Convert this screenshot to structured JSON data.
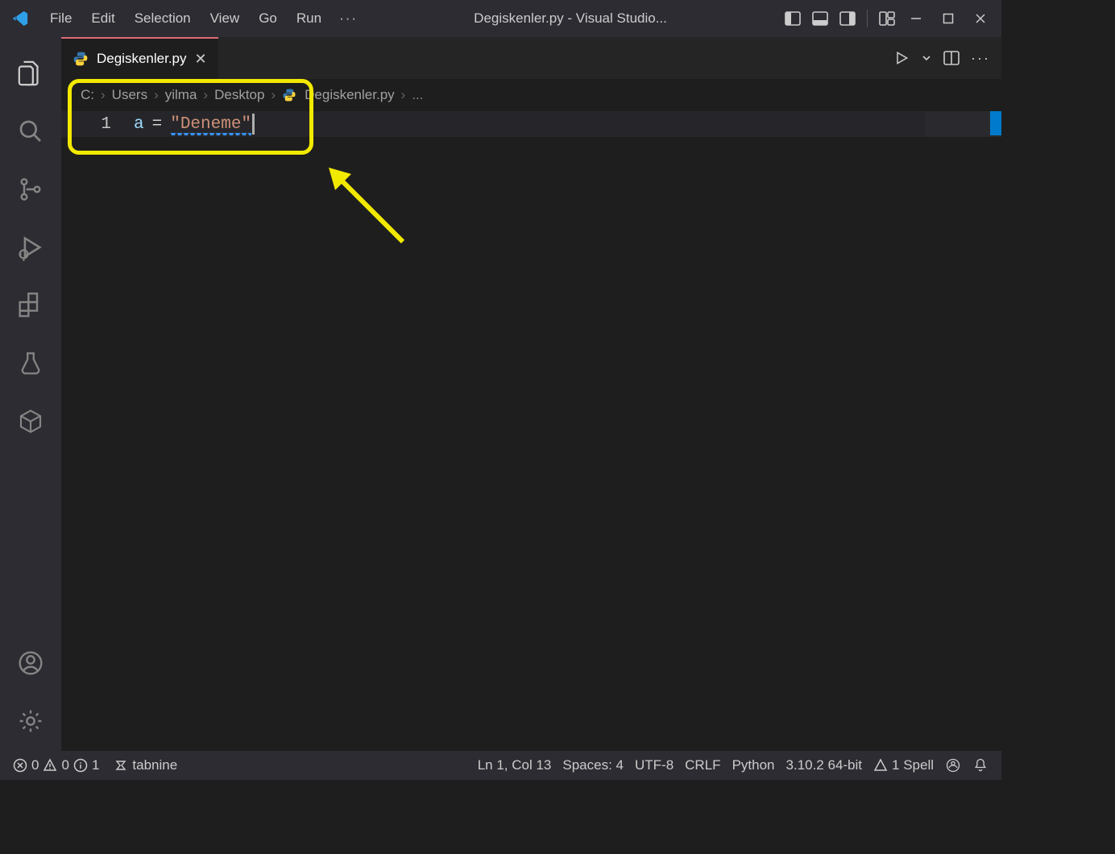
{
  "titlebar": {
    "menus": [
      "File",
      "Edit",
      "Selection",
      "View",
      "Go",
      "Run"
    ],
    "more": "···",
    "title": "Degiskenler.py - Visual Studio..."
  },
  "tab": {
    "label": "Degiskenler.py"
  },
  "breadcrumb": {
    "parts": [
      "C:",
      "Users",
      "yilma",
      "Desktop"
    ],
    "file": "Degiskenler.py",
    "more": "..."
  },
  "code": {
    "line_number": "1",
    "variable": "a",
    "operator": "=",
    "string": "\"Deneme\""
  },
  "status": {
    "errors": "0",
    "warnings": "0",
    "info": "1",
    "ext": "tabnine",
    "cursor": "Ln 1, Col 13",
    "spaces": "Spaces: 4",
    "encoding": "UTF-8",
    "eol": "CRLF",
    "lang": "Python",
    "interp": "3.10.2 64-bit",
    "spell": "1 Spell"
  }
}
